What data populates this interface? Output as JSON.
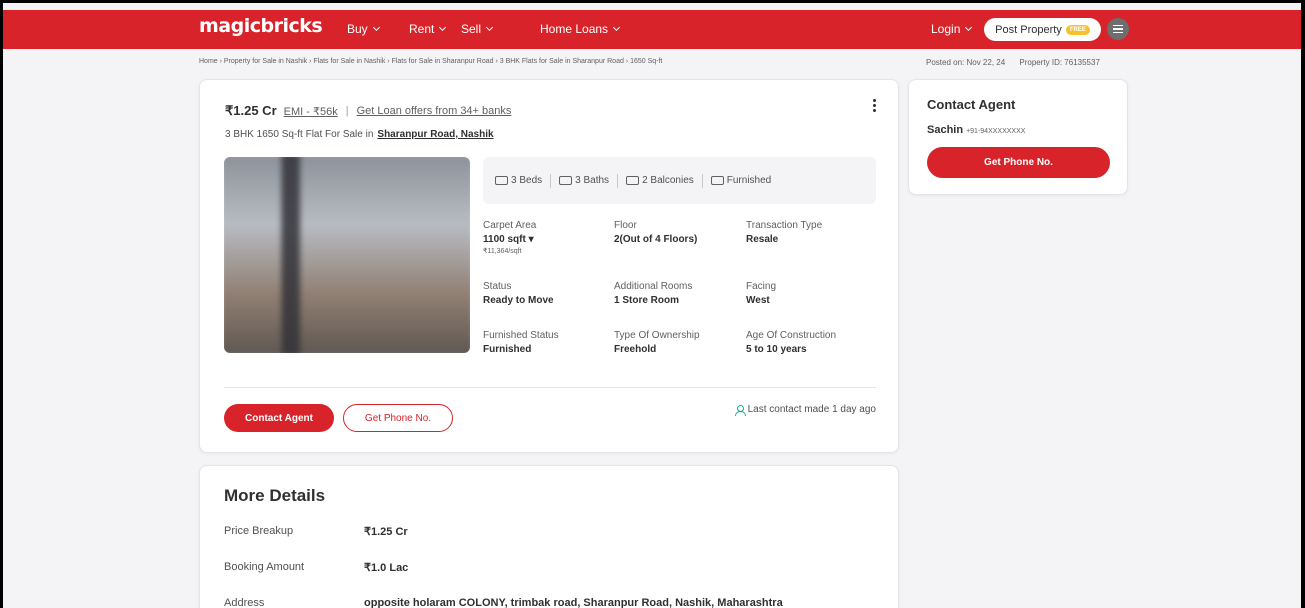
{
  "header": {
    "logo": "magicbricks",
    "nav": [
      {
        "label": "Buy"
      },
      {
        "label": "Rent"
      },
      {
        "label": "Sell"
      },
      {
        "label": "Home Loans"
      }
    ],
    "login": "Login",
    "post_property": "Post Property",
    "free_badge": "FREE"
  },
  "breadcrumb": "Home › Property for Sale in Nashik › Flats for Sale in Nashik › Flats for Sale in Sharanpur Road › 3 BHK Flats for Sale in Sharanpur Road › 1650 Sq-ft",
  "meta": {
    "posted": "Posted on: Nov 22, 24",
    "property_id": "Property ID: 76135537"
  },
  "listing": {
    "price": "₹1.25 Cr",
    "emi": "EMI - ₹56k",
    "loan_offer": "Get Loan offers from 34+ banks",
    "title": "3 BHK 1650 Sq-ft Flat For Sale in",
    "location": "Sharanpur Road, Nashik",
    "amenities": [
      {
        "label": "3 Beds"
      },
      {
        "label": "3 Baths"
      },
      {
        "label": "2 Balconies"
      },
      {
        "label": "Furnished"
      }
    ],
    "facts": [
      {
        "label": "Carpet Area",
        "value": "1100 sqft ▾",
        "sub": "₹11,364/sqft"
      },
      {
        "label": "Floor",
        "value": "2(Out of 4 Floors)"
      },
      {
        "label": "Transaction Type",
        "value": "Resale"
      },
      {
        "label": "Status",
        "value": "Ready to Move"
      },
      {
        "label": "Additional Rooms",
        "value": "1 Store Room"
      },
      {
        "label": "Facing",
        "value": "West"
      },
      {
        "label": "Furnished Status",
        "value": "Furnished"
      },
      {
        "label": "Type Of Ownership",
        "value": "Freehold"
      },
      {
        "label": "Age Of Construction",
        "value": "5 to 10 years"
      }
    ],
    "contact_agent_btn": "Contact Agent",
    "get_phone_btn": "Get Phone No.",
    "last_contact": "Last contact made 1 day ago"
  },
  "contact_card": {
    "heading": "Contact Agent",
    "agent_name": "Sachin",
    "agent_phone": "+91-94XXXXXXXX",
    "button": "Get Phone No."
  },
  "more_details": {
    "heading": "More Details",
    "rows": [
      {
        "key": "Price Breakup",
        "value": "₹1.25 Cr"
      },
      {
        "key": "Booking Amount",
        "value": "₹1.0 Lac"
      },
      {
        "key": "Address",
        "value": "opposite holaram COLONY, trimbak road, Sharanpur Road, Nashik, Maharashtra"
      }
    ]
  },
  "colors": {
    "brand_red": "#d8232a",
    "accent_teal": "#13a89e"
  }
}
